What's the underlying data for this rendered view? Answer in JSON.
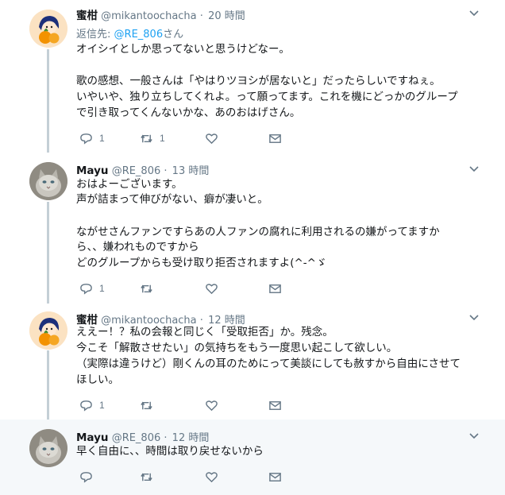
{
  "tweets": [
    {
      "name": "蜜柑",
      "handle": "@mikantoochacha",
      "separator": "·",
      "time": "20 時間",
      "reply_prefix": "返信先:",
      "reply_handle": "@RE_806",
      "reply_suffix": "さん",
      "lines": [
        "オイシイとしか思ってないと思うけどなー。",
        "",
        "歌の感想、一般さんは「やはりツヨシが居ないと」だったらしいですねぇ。",
        "いやいや、独り立ちしてくれよ。って願ってます。これを機にどっかのグループ",
        "で引き取ってくんないかな、あのおはげさん。"
      ],
      "reply_count": "1",
      "retweet_count": "1",
      "like_count": ""
    },
    {
      "name": "Mayu",
      "handle": "@RE_806",
      "separator": "·",
      "time": "13 時間",
      "lines": [
        "おはよーございます。",
        "声が詰まって伸びがない、癖が凄いと。",
        "",
        "ながせさんファンですらあの人ファンの腐れに利用されるの嫌がってますか",
        "ら、、嫌われものですから",
        "どのグループからも受け取り拒否されますよ(^-^ゞ"
      ],
      "reply_count": "1",
      "retweet_count": "",
      "like_count": ""
    },
    {
      "name": "蜜柑",
      "handle": "@mikantoochacha",
      "separator": "·",
      "time": "12 時間",
      "lines": [
        "ええー！？私の会報と同じく「受取拒否」か。残念。",
        "今こそ「解散させたい」の気持ちをもう一度思い起こして欲しい。",
        "（実際は違うけど）剛くんの耳のためにって美談にしても赦すから自由にさせて",
        "ほしい。"
      ],
      "reply_count": "1",
      "retweet_count": "",
      "like_count": ""
    },
    {
      "name": "Mayu",
      "handle": "@RE_806",
      "separator": "·",
      "time": "12 時間",
      "lines": [
        "早く自由に、、時間は取り戻せないから"
      ],
      "reply_count": "",
      "retweet_count": "",
      "like_count": ""
    }
  ],
  "colors": {
    "link": "#1da1f2",
    "muted": "#657786",
    "text": "#14171a",
    "connector": "#c4cfd6",
    "highlight_bg": "#f5f8fa"
  },
  "icons": {
    "reply": "reply-icon",
    "retweet": "retweet-icon",
    "like": "heart-icon",
    "dm": "envelope-icon",
    "more": "chevron-down-icon"
  }
}
